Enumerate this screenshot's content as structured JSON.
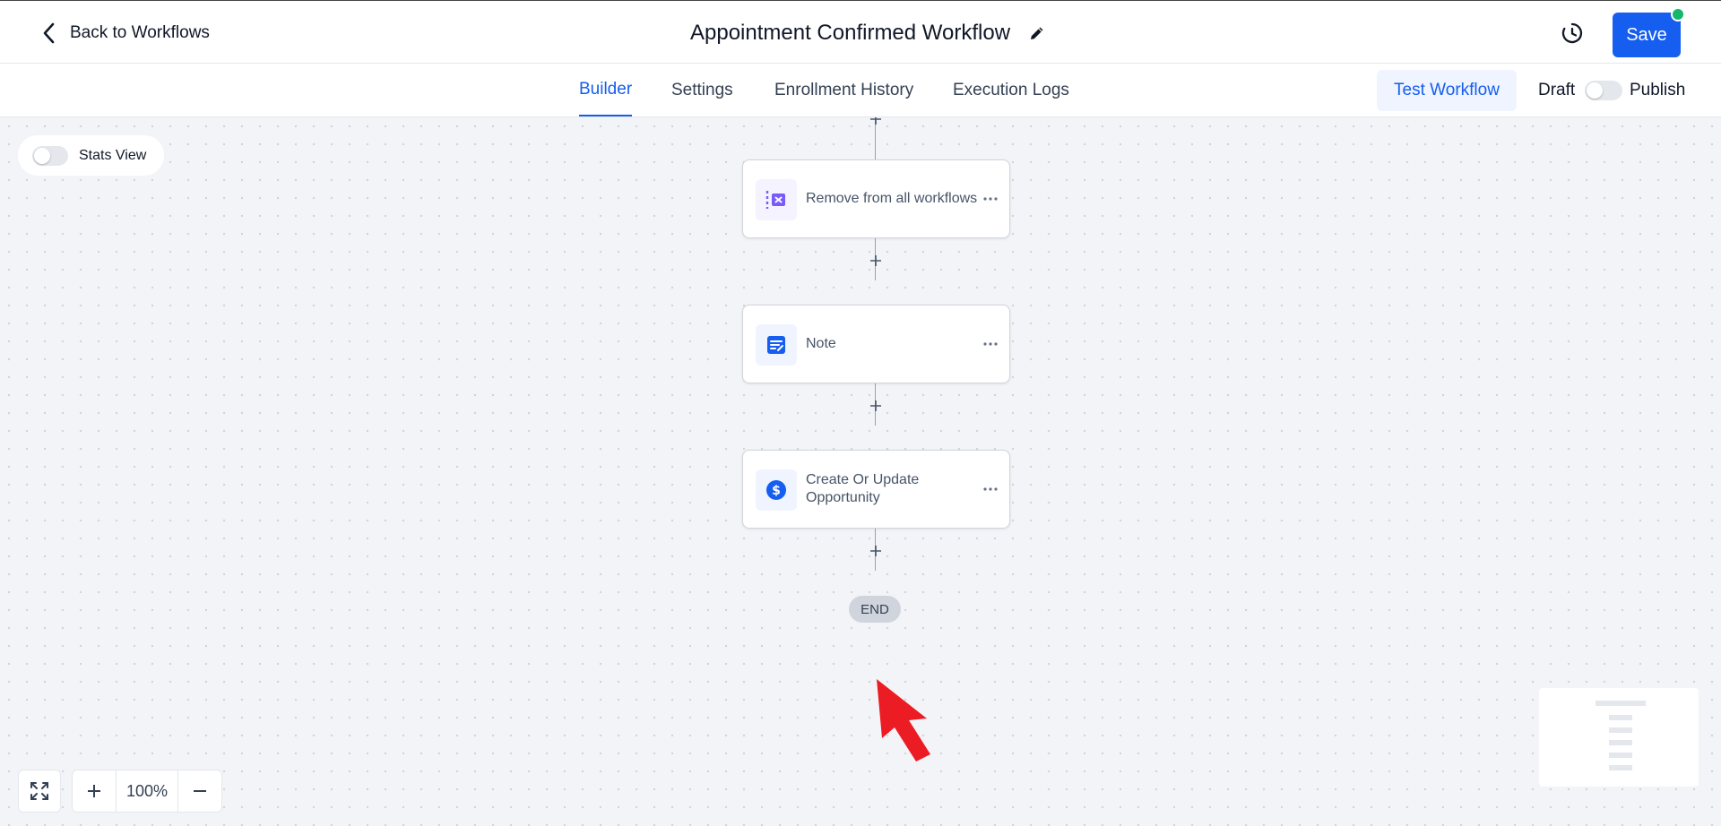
{
  "header": {
    "back_label": "Back to Workflows",
    "title": "Appointment Confirmed Workflow",
    "save_label": "Save",
    "colors": {
      "primary": "#155eef",
      "status_dot": "#12b76a"
    }
  },
  "tabs": [
    {
      "label": "Builder",
      "active": true
    },
    {
      "label": "Settings",
      "active": false
    },
    {
      "label": "Enrollment History",
      "active": false
    },
    {
      "label": "Execution Logs",
      "active": false
    }
  ],
  "actions": {
    "test_label": "Test Workflow",
    "draft_label": "Draft",
    "publish_label": "Publish",
    "published": false
  },
  "canvas": {
    "stats_view_label": "Stats View",
    "stats_view_on": false,
    "nodes": [
      {
        "label": "Remove from all workflows",
        "icon": "remove-workflow-icon",
        "icon_color": "#7a5af8"
      },
      {
        "label": "Note",
        "icon": "note-icon",
        "icon_color": "#155eef"
      },
      {
        "label": "Create Or Update Opportunity",
        "icon": "dollar-icon",
        "icon_color": "#155eef"
      }
    ],
    "end_label": "END",
    "zoom": "100%"
  }
}
